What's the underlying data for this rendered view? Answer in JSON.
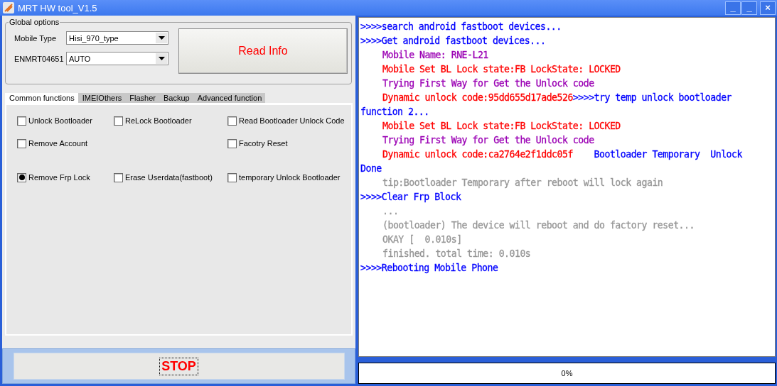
{
  "window": {
    "title": "MRT HW tool_V1.5",
    "controls": [
      "_",
      "_",
      "×"
    ]
  },
  "global_options": {
    "title": "Global options",
    "fields": [
      {
        "label": "Mobile Type",
        "value": "Hisi_970_type"
      },
      {
        "label": "ENMRT04651",
        "value": "AUTO"
      }
    ],
    "read_button": "Read Info"
  },
  "tabs": [
    {
      "label": "Common functions",
      "selected": true
    },
    {
      "label": "IMEIOthers",
      "selected": false
    },
    {
      "label": "Flasher",
      "selected": false
    },
    {
      "label": "Backup",
      "selected": false
    },
    {
      "label": "Advanced function",
      "selected": false
    }
  ],
  "options": [
    [
      {
        "kind": "checkbox",
        "label": "Unlock Bootloader",
        "checked": false
      },
      {
        "kind": "checkbox",
        "label": "ReLock Bootloader",
        "checked": false
      },
      {
        "kind": "checkbox",
        "label": "Read Bootloader Unlock Code",
        "checked": false
      }
    ],
    [
      {
        "kind": "checkbox",
        "label": "Remove Account",
        "checked": false
      },
      {
        "kind": "blank"
      },
      {
        "kind": "checkbox",
        "label": "Facotry Reset",
        "checked": false
      }
    ],
    [
      {
        "kind": "radio",
        "label": "Remove Frp Lock",
        "checked": true
      },
      {
        "kind": "checkbox",
        "label": "Erase Userdata(fastboot)",
        "checked": false
      },
      {
        "kind": "checkbox",
        "label": "temporary Unlock Bootloader",
        "checked": false
      }
    ]
  ],
  "stop_button": "STOP",
  "log": [
    {
      "indent": false,
      "segments": [
        {
          "text": ">>>>search android fastboot devices...",
          "color": "#0000ff"
        }
      ]
    },
    {
      "indent": false,
      "segments": [
        {
          "text": ">>>>Get android fastboot devices...",
          "color": "#0000ff"
        }
      ]
    },
    {
      "indent": true,
      "segments": [
        {
          "text": "Mobile Name: RNE-L21",
          "color": "#9b00b4"
        }
      ]
    },
    {
      "indent": true,
      "segments": [
        {
          "text": "Mobile Set BL Lock state:FB LockState: LOCKED",
          "color": "#ff0000"
        }
      ]
    },
    {
      "indent": true,
      "segments": [
        {
          "text": "Trying First Way for Get the Unlock code",
          "color": "#9b00b4"
        }
      ]
    },
    {
      "indent": true,
      "segments": [
        {
          "text": "Dynamic unlock code:95dd655d17ade526",
          "color": "#ff0000"
        },
        {
          "text": ">>>>try temp unlock bootloader",
          "color": "#0000ff"
        }
      ]
    },
    {
      "indent": false,
      "segments": [
        {
          "text": "function 2...",
          "color": "#0000ff"
        }
      ]
    },
    {
      "indent": true,
      "segments": [
        {
          "text": "Mobile Set BL Lock state:FB LockState: LOCKED",
          "color": "#ff0000"
        }
      ]
    },
    {
      "indent": true,
      "segments": [
        {
          "text": "Trying First Way for Get the Unlock code",
          "color": "#9b00b4"
        }
      ]
    },
    {
      "indent": true,
      "segments": [
        {
          "text": "Dynamic unlock code:ca2764e2f1ddc05f",
          "color": "#ff0000"
        },
        {
          "text": "    Bootloader Temporary  Unlock",
          "color": "#0000ff"
        }
      ]
    },
    {
      "indent": false,
      "segments": [
        {
          "text": "Done",
          "color": "#0000ff"
        }
      ]
    },
    {
      "indent": true,
      "segments": [
        {
          "text": "tip:Bootloader Temporary after reboot will lock again",
          "color": "#969696"
        }
      ]
    },
    {
      "indent": false,
      "segments": [
        {
          "text": ">>>>Clear Frp Block",
          "color": "#0000ff"
        }
      ]
    },
    {
      "indent": true,
      "segments": [
        {
          "text": "...",
          "color": "#969696"
        }
      ]
    },
    {
      "indent": true,
      "segments": [
        {
          "text": "(bootloader) The device will reboot and do factory reset...",
          "color": "#969696"
        }
      ]
    },
    {
      "indent": true,
      "segments": [
        {
          "text": "OKAY [  0.010s]",
          "color": "#969696"
        }
      ]
    },
    {
      "indent": true,
      "segments": [
        {
          "text": "finished. total time: 0.010s",
          "color": "#969696"
        }
      ]
    },
    {
      "indent": false,
      "segments": [
        {
          "text": ">>>>Rebooting Mobile Phone",
          "color": "#0000ff"
        }
      ]
    }
  ],
  "progress": {
    "level": 0,
    "text": "0%"
  }
}
